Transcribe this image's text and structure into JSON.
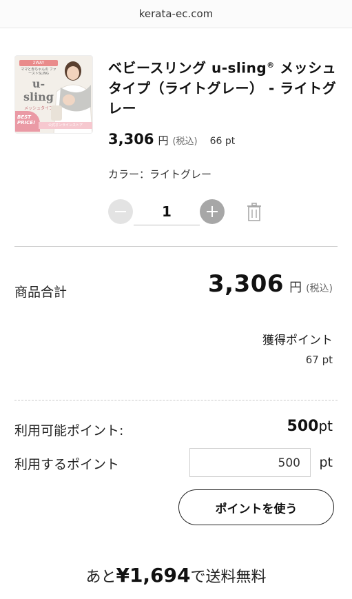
{
  "browser": {
    "url": "kerata-ec.com"
  },
  "product": {
    "title_line1": "ベビースリング u-sling",
    "registered": "®",
    "title_line1_tail": " メッシュ",
    "title_rest": "タイプ（ライトグレー） - ライトグレー",
    "price": "3,306",
    "yen": "円",
    "tax": "(税込)",
    "points": "66 pt",
    "color": "カラー：ライトグレー",
    "quantity": "1",
    "thumb": {
      "top_tag": "2WAY",
      "tiny_text": "ママと赤ちゃんの ファーストSLING",
      "logo": "u-sling",
      "mesh": "メッシュタイプ",
      "best": "BEST PRICE!",
      "band": "公式オンラインストア",
      "colors": {
        "pink": "#ea9aa5",
        "tag": "#e98b8b"
      }
    }
  },
  "summary": {
    "subtotal_label": "商品合計",
    "subtotal": "3,306",
    "yen": "円",
    "tax": "(税込)",
    "earn_label": "獲得ポイント",
    "earn_value": "67 pt"
  },
  "points": {
    "available_label": "利用可能ポイント:",
    "available_value": "500",
    "available_unit": "pt",
    "use_label": "利用するポイント",
    "use_value": "500",
    "use_unit": "pt",
    "use_button": "ポイントを使う"
  },
  "shipping": {
    "prefix": "あと",
    "amount": "¥1,694",
    "suffix": "で送料無料"
  },
  "icons": [
    "minus-icon",
    "plus-icon",
    "trash-icon"
  ]
}
